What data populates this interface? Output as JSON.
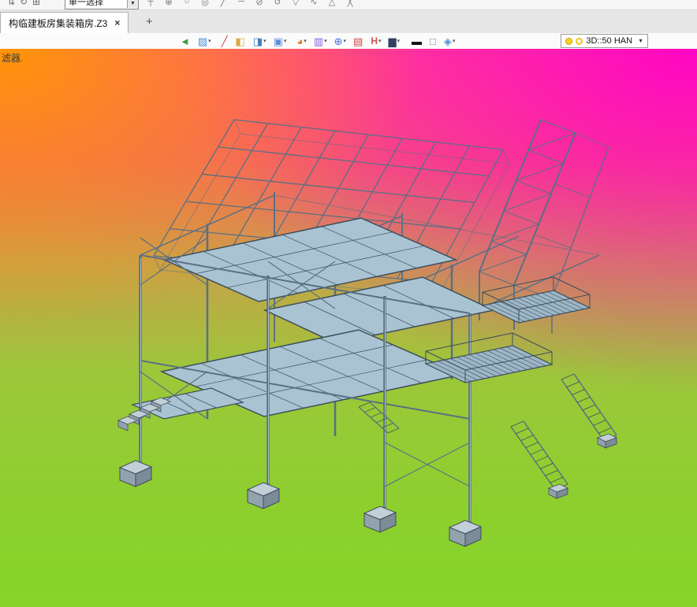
{
  "top_strip": {
    "left_icons": [
      {
        "name": "pan-tool-icon",
        "glyph": "⇅"
      },
      {
        "name": "orbit-tool-icon",
        "glyph": "↻"
      },
      {
        "name": "grid-tool-icon",
        "glyph": "⊞"
      }
    ],
    "selection_combo": {
      "value": "单一选择",
      "caret": "▼"
    },
    "right_icons": [
      {
        "glyph": "┼"
      },
      {
        "glyph": "⊕"
      },
      {
        "glyph": "○"
      },
      {
        "glyph": "◎"
      },
      {
        "glyph": "╱"
      },
      {
        "glyph": "─"
      },
      {
        "glyph": "⊘"
      },
      {
        "glyph": "↺"
      },
      {
        "glyph": "▽"
      },
      {
        "glyph": "∿"
      },
      {
        "glyph": "△"
      },
      {
        "glyph": "╳"
      }
    ]
  },
  "tab_bar": {
    "tabs": [
      {
        "label": "构临建板房集装箱房.Z3",
        "close_glyph": "×",
        "active": true
      }
    ],
    "new_tab_label": "+"
  },
  "view_toolbar": {
    "icons": [
      {
        "name": "exit-environment-icon",
        "glyph": "◄",
        "caret": ""
      },
      {
        "name": "render-shade-icon",
        "glyph": "▨",
        "caret": "▾"
      },
      {
        "name": "edit-pencil-icon",
        "glyph": "╱",
        "caret": ""
      },
      {
        "name": "solid-yellow-box-icon",
        "glyph": "◧",
        "caret": ""
      },
      {
        "name": "solid-blue-box-icon",
        "glyph": "◨",
        "caret": "▾"
      },
      {
        "name": "view-cube-icon",
        "glyph": "▣",
        "caret": "▾"
      },
      {
        "name": "color-wheel-icon",
        "glyph": "◕",
        "caret": "▾"
      },
      {
        "name": "section-view-icon",
        "glyph": "▥",
        "caret": "▾"
      },
      {
        "name": "locate-target-icon",
        "glyph": "⊕",
        "caret": "▾"
      },
      {
        "name": "window-view-icon",
        "glyph": "▤",
        "caret": ""
      },
      {
        "name": "dimension-style-icon",
        "glyph": "H",
        "caret": "▾"
      },
      {
        "name": "display-mode-icon",
        "glyph": "▆",
        "caret": "▾"
      },
      {
        "name": "hide-bar-icon",
        "glyph": "▬",
        "caret": ""
      },
      {
        "name": "blank-swatch-icon",
        "glyph": "□",
        "caret": ""
      },
      {
        "name": "visibility-layers-icon",
        "glyph": "◈",
        "caret": "▾"
      }
    ],
    "layer_combo": {
      "value": "3D::50 HAN",
      "caret": "▼"
    }
  },
  "viewport": {
    "prompt_text": "滤器.",
    "background_colors": {
      "top_left": "#ff9900",
      "top_right": "#ff00c8",
      "center_top": "#ff5f7a",
      "bottom": "#8ccf2e"
    },
    "model_colors": {
      "member": "#5a7083",
      "outline": "#3e4e5b",
      "panel": "#a9c3d3",
      "grating": "#9db7c7",
      "footing": "#c3cfd7"
    }
  }
}
